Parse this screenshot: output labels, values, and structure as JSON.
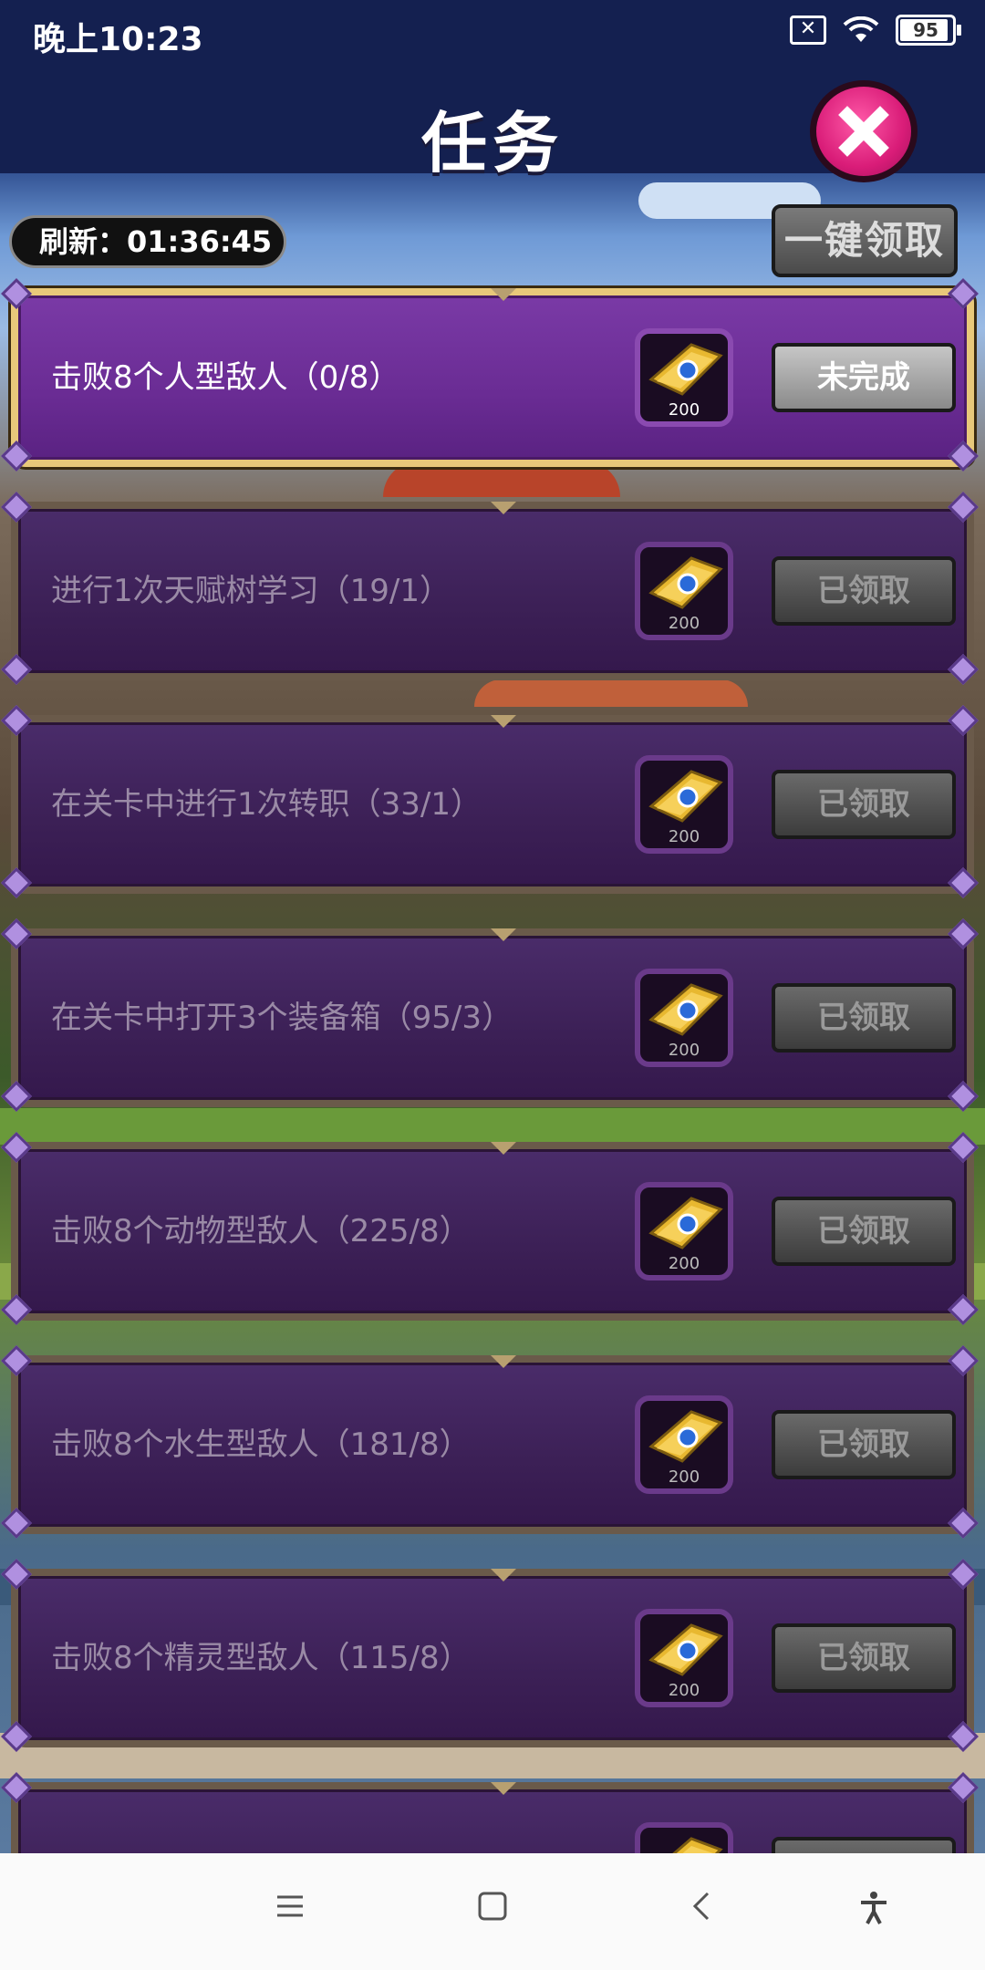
{
  "status_bar": {
    "time": "晚上10:23",
    "battery": "95"
  },
  "header": {
    "title": "任务",
    "refresh": "刷新：01:36:45",
    "claim_all": "一键领取"
  },
  "tasks": [
    {
      "label": "击败8个人型敌人（0/8）",
      "reward": "200",
      "status": "未完成",
      "active": true
    },
    {
      "label": "进行1次天赋树学习（19/1）",
      "reward": "200",
      "status": "已领取",
      "active": false
    },
    {
      "label": "在关卡中进行1次转职（33/1）",
      "reward": "200",
      "status": "已领取",
      "active": false
    },
    {
      "label": "在关卡中打开3个装备箱（95/3）",
      "reward": "200",
      "status": "已领取",
      "active": false
    },
    {
      "label": "击败8个动物型敌人（225/8）",
      "reward": "200",
      "status": "已领取",
      "active": false
    },
    {
      "label": "击败8个水生型敌人（181/8）",
      "reward": "200",
      "status": "已领取",
      "active": false
    },
    {
      "label": "击败8个精灵型敌人（115/8）",
      "reward": "200",
      "status": "已领取",
      "active": false
    },
    {
      "label": "",
      "reward": "",
      "status": "",
      "active": false
    }
  ],
  "icons": {
    "close": "close-icon",
    "reward": "ticket-icon",
    "nav": [
      "menu-icon",
      "home-icon",
      "back-icon",
      "accessibility-icon"
    ]
  }
}
